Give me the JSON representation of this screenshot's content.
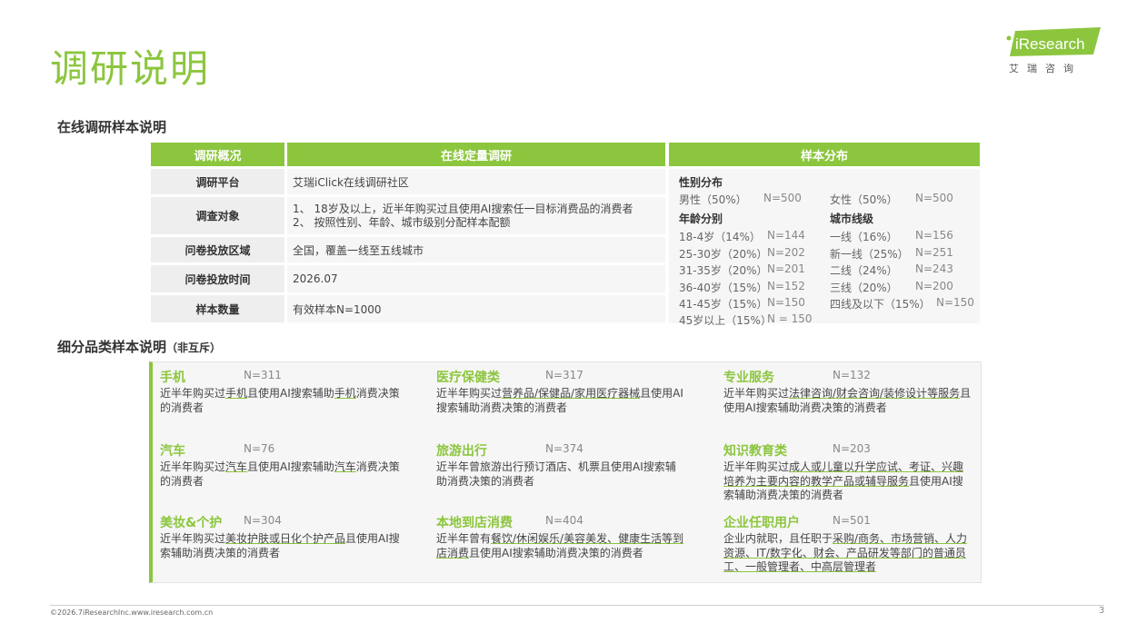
{
  "title": "调研说明",
  "logo": {
    "brand": "iResearch",
    "sub": "艾瑞咨询",
    "accent": "#8cc63e"
  },
  "section1_title": "在线调研样本说明",
  "table": {
    "headers": [
      "调研概况",
      "在线定量调研",
      "样本分布"
    ],
    "rows": [
      {
        "label": "调研平台",
        "value": "艾瑞iClick在线调研社区"
      },
      {
        "label": "调查对象",
        "lines": [
          "1、 18岁及以上，近半年购买过且使用AI搜索任一目标消费品的消费者",
          "2、 按照性别、年龄、城市级别分配样本配额"
        ]
      },
      {
        "label": "问卷投放区域",
        "value": "全国，覆盖一线至五线城市"
      },
      {
        "label": "问卷投放时间",
        "value": "2026.07"
      },
      {
        "label": "样本数量",
        "value": "有效样本N=1000"
      }
    ]
  },
  "distribution": {
    "gender_title": "性别分布",
    "gender": [
      {
        "label": "男性（50%）",
        "n": "N=500"
      },
      {
        "label": "女性（50%）",
        "n": "N=500"
      }
    ],
    "age_title": "年龄分别",
    "age": [
      {
        "label": "18-4岁（14%）",
        "n": "N=144"
      },
      {
        "label": "25-30岁（20%）",
        "n": "N=202"
      },
      {
        "label": "31-35岁（20%）",
        "n": "N=201"
      },
      {
        "label": "36-40岁（15%）",
        "n": "N=152"
      },
      {
        "label": "41-45岁（15%）",
        "n": "N=150"
      },
      {
        "label": "45岁以上（15%）",
        "n": "N = 150"
      }
    ],
    "city_title": "城市线级",
    "city": [
      {
        "label": "一线（16%）",
        "n": "N=156"
      },
      {
        "label": "新一线（25%）",
        "n": "N=251"
      },
      {
        "label": "二线（24%）",
        "n": "N=243"
      },
      {
        "label": "三线（20%）",
        "n": "N=200"
      },
      {
        "label": "四线及以下（15%）",
        "n": "N=150"
      }
    ]
  },
  "section2_title": "细分品类样本说明",
  "section2_note": "（非互斥）",
  "categories": [
    {
      "name": "手机",
      "n": "N=311",
      "desc": [
        [
          "近半年购买过",
          false
        ],
        [
          "手机",
          true
        ],
        [
          "且使用AI搜索辅助",
          false
        ],
        [
          "手机",
          true
        ],
        [
          "消费决策的消费者",
          false
        ]
      ]
    },
    {
      "name": "医疗保健类",
      "n": "N=317",
      "desc": [
        [
          "近半年购买过",
          false
        ],
        [
          "营养品/保健品/家用医疗器械",
          true
        ],
        [
          "且使用AI搜索辅助消费决策的消费者",
          false
        ]
      ]
    },
    {
      "name": "专业服务",
      "n": "N=132",
      "desc": [
        [
          "近半年购买过",
          false
        ],
        [
          "法律咨询/财会咨询/装修设计等服务",
          true
        ],
        [
          "且使用AI搜索辅助消费决策的消费者",
          false
        ]
      ]
    },
    {
      "name": "汽车",
      "n": "N=76",
      "desc": [
        [
          "近半年购买过",
          false
        ],
        [
          "汽车",
          true
        ],
        [
          "且使用AI搜索辅助",
          false
        ],
        [
          "汽车",
          true
        ],
        [
          "消费决策的消费者",
          false
        ]
      ]
    },
    {
      "name": "旅游出行",
      "n": "N=374",
      "desc": [
        [
          "近半年曾旅游出行预订酒店、机票且使用AI搜索辅助消费决策的消费者",
          false
        ]
      ]
    },
    {
      "name": "知识教育类",
      "n": "N=203",
      "desc": [
        [
          "近半年购买过",
          false
        ],
        [
          "成人或儿童以升学应试、考证、兴趣培养为主要内容的教学产品或辅导服务",
          true
        ],
        [
          "且使用AI搜索辅助消费决策的消费者",
          false
        ]
      ]
    },
    {
      "name": "美妆&个护",
      "n": "N=304",
      "desc": [
        [
          "近半年购买过",
          false
        ],
        [
          "美妆护肤或日化个护产品",
          true
        ],
        [
          "且使用AI搜索辅助消费决策的消费者",
          false
        ]
      ]
    },
    {
      "name": "本地到店消费",
      "n": "N=404",
      "desc": [
        [
          "近半年曾有",
          false
        ],
        [
          "餐饮/休闲娱乐/美容美发、健康生活等到店消费",
          true
        ],
        [
          "且使用AI搜索辅助消费决策的消费者",
          false
        ]
      ]
    },
    {
      "name": "企业任职用户",
      "n": "N=501",
      "desc": [
        [
          "企业内就职，且任职于",
          false
        ],
        [
          "采购/商务、市场营销、人力资源、IT/数字化、财会、产品研发等部门的普通员工、一般管理者、中高层管理者",
          true
        ]
      ]
    }
  ],
  "footer": "©2026.7iResearchInc.www.iresearch.com.cn",
  "page_number": "3"
}
